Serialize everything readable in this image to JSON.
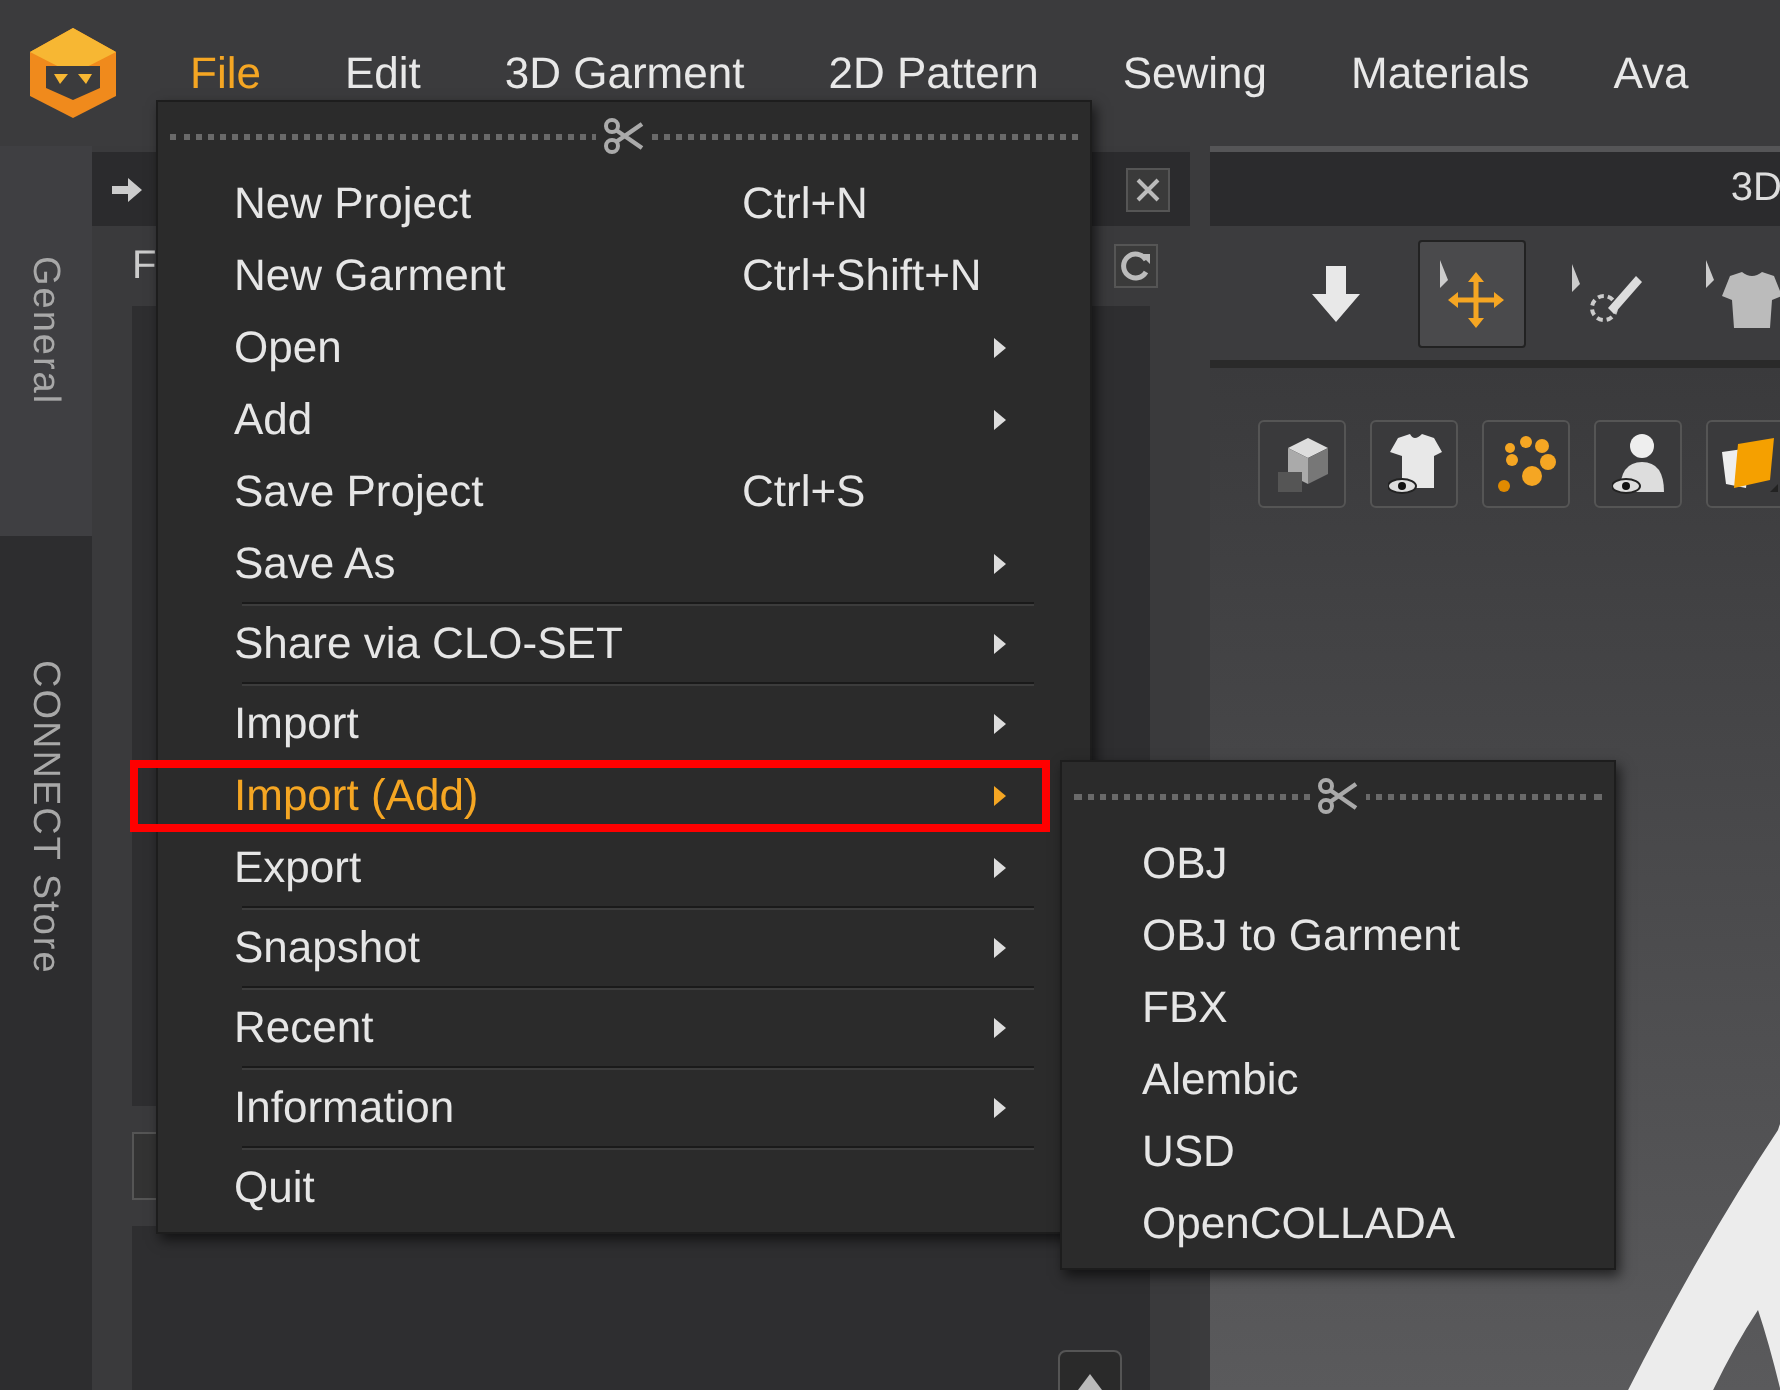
{
  "menubar": [
    {
      "label": "File",
      "selected": true
    },
    {
      "label": "Edit",
      "selected": false
    },
    {
      "label": "3D Garment",
      "selected": false
    },
    {
      "label": "2D Pattern",
      "selected": false
    },
    {
      "label": "Sewing",
      "selected": false
    },
    {
      "label": "Materials",
      "selected": false
    },
    {
      "label": "Ava",
      "selected": false
    }
  ],
  "side_tabs": [
    {
      "label": "General"
    },
    {
      "label": "CONNECT Store"
    }
  ],
  "left_panel": {
    "heading": "F"
  },
  "viewport": {
    "title": "3D"
  },
  "file_menu": {
    "items": [
      {
        "label": "New Project",
        "shortcut": "Ctrl+N",
        "has_submenu": false,
        "selected": false,
        "separator_after": false
      },
      {
        "label": "New Garment",
        "shortcut": "Ctrl+Shift+N",
        "has_submenu": false,
        "selected": false,
        "separator_after": false
      },
      {
        "label": "Open",
        "has_submenu": true,
        "selected": false,
        "separator_after": false
      },
      {
        "label": "Add",
        "has_submenu": true,
        "selected": false,
        "separator_after": false
      },
      {
        "label": "Save Project",
        "shortcut": "Ctrl+S",
        "has_submenu": false,
        "selected": false,
        "separator_after": false
      },
      {
        "label": "Save As",
        "has_submenu": true,
        "selected": false,
        "separator_after": true
      },
      {
        "label": "Share via CLO-SET",
        "has_submenu": true,
        "selected": false,
        "separator_after": true
      },
      {
        "label": "Import",
        "has_submenu": true,
        "selected": false,
        "separator_after": false
      },
      {
        "label": "Import (Add)",
        "has_submenu": true,
        "selected": true,
        "separator_after": false
      },
      {
        "label": "Export",
        "has_submenu": true,
        "selected": false,
        "separator_after": true
      },
      {
        "label": "Snapshot",
        "has_submenu": true,
        "selected": false,
        "separator_after": true
      },
      {
        "label": "Recent",
        "has_submenu": true,
        "selected": false,
        "separator_after": true
      },
      {
        "label": "Information",
        "has_submenu": true,
        "selected": false,
        "separator_after": true
      },
      {
        "label": "Quit",
        "has_submenu": false,
        "selected": false,
        "separator_after": false
      }
    ]
  },
  "import_submenu": {
    "items": [
      {
        "label": "OBJ",
        "selected": false
      },
      {
        "label": "OBJ to Garment",
        "selected": false
      },
      {
        "label": "FBX",
        "selected": false
      },
      {
        "label": "Alembic",
        "selected": false
      },
      {
        "label": "USD",
        "selected": false
      },
      {
        "label": "OpenCOLLADA",
        "selected": false
      }
    ]
  }
}
